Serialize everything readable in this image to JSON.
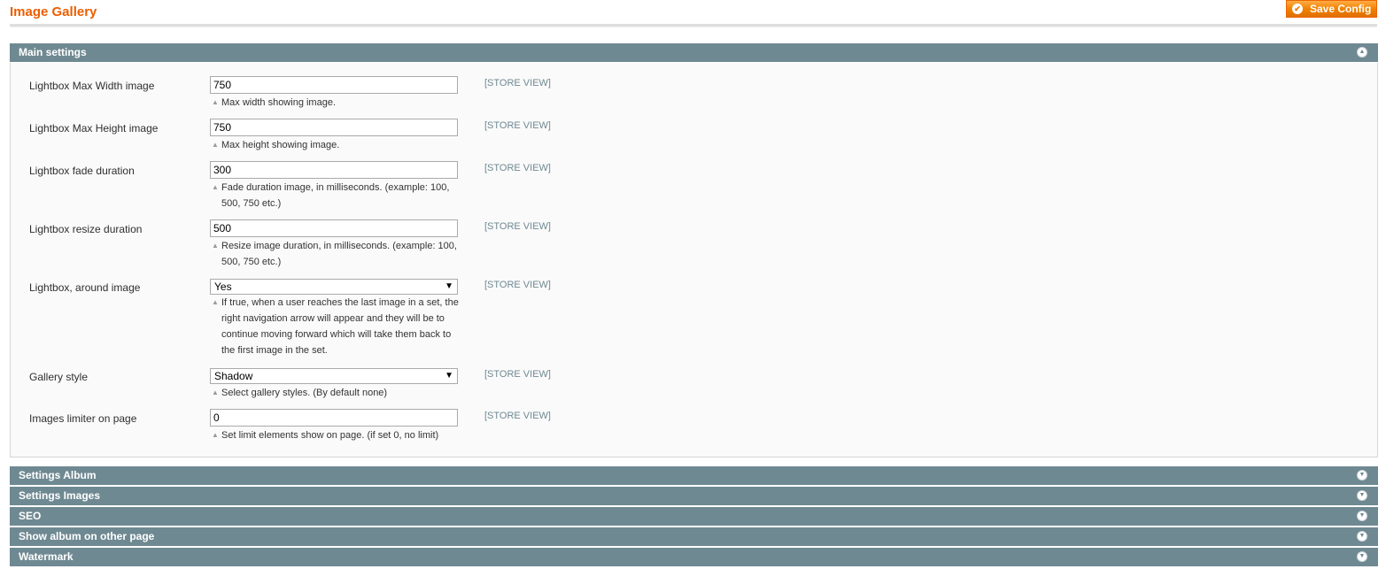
{
  "page": {
    "title": "Image Gallery",
    "save_label": "Save Config"
  },
  "main_section": {
    "title": "Main settings",
    "fields": [
      {
        "label": "Lightbox Max Width image",
        "type": "text",
        "value": "750",
        "scope": "[STORE VIEW]",
        "note": "Max width showing image."
      },
      {
        "label": "Lightbox Max Height image",
        "type": "text",
        "value": "750",
        "scope": "[STORE VIEW]",
        "note": "Max height showing image."
      },
      {
        "label": "Lightbox fade duration",
        "type": "text",
        "value": "300",
        "scope": "[STORE VIEW]",
        "note": "Fade duration image, in milliseconds. (example: 100, 500, 750 etc.)"
      },
      {
        "label": "Lightbox resize duration",
        "type": "text",
        "value": "500",
        "scope": "[STORE VIEW]",
        "note": "Resize image duration, in milliseconds. (example: 100, 500, 750 etc.)"
      },
      {
        "label": "Lightbox, around image",
        "type": "select",
        "value": "Yes",
        "scope": "[STORE VIEW]",
        "note": "If true, when a user reaches the last image in a set, the right navigation arrow will appear and they will be to continue moving forward which will take them back to the first image in the set."
      },
      {
        "label": "Gallery style",
        "type": "select",
        "value": "Shadow",
        "scope": "[STORE VIEW]",
        "note": "Select gallery styles. (By default none)"
      },
      {
        "label": "Images limiter on page",
        "type": "text",
        "value": "0",
        "scope": "[STORE VIEW]",
        "note": "Set limit elements show on page. (if set 0, no limit)"
      }
    ]
  },
  "collapsed_sections": [
    {
      "title": "Settings Album"
    },
    {
      "title": "Settings Images"
    },
    {
      "title": "SEO"
    },
    {
      "title": "Show album on other page"
    },
    {
      "title": "Watermark"
    }
  ],
  "icons": {
    "save": "check-circle-icon",
    "collapse": "chevron-up-icon",
    "expand": "chevron-down-icon"
  },
  "colors": {
    "title": "#eb5e00",
    "section_header": "#6f8992",
    "button": "#f18200"
  }
}
